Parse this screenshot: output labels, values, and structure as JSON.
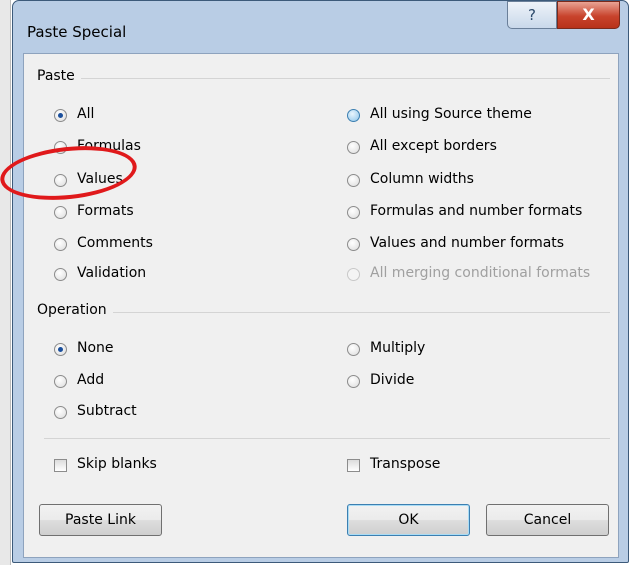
{
  "window": {
    "title": "Paste Special",
    "help_label": "?",
    "close_label": "X"
  },
  "paste": {
    "label": "Paste",
    "left_options": [
      "All",
      "Formulas",
      "Values",
      "Formats",
      "Comments",
      "Validation"
    ],
    "right_options": [
      "All using Source theme",
      "All except borders",
      "Column widths",
      "Formulas and number formats",
      "Values and number formats",
      "All merging conditional formats"
    ],
    "selected": "All",
    "disabled": "All merging conditional formats"
  },
  "operation": {
    "label": "Operation",
    "left_options": [
      "None",
      "Add",
      "Subtract"
    ],
    "right_options": [
      "Multiply",
      "Divide"
    ],
    "selected": "None"
  },
  "checkboxes": {
    "skip_blanks": "Skip blanks",
    "transpose": "Transpose"
  },
  "buttons": {
    "paste_link": "Paste Link",
    "ok": "OK",
    "cancel": "Cancel"
  },
  "colors": {
    "title_bar": "#b9cde5",
    "panel": "#f0f0f0",
    "annotation": "#e0191b"
  }
}
